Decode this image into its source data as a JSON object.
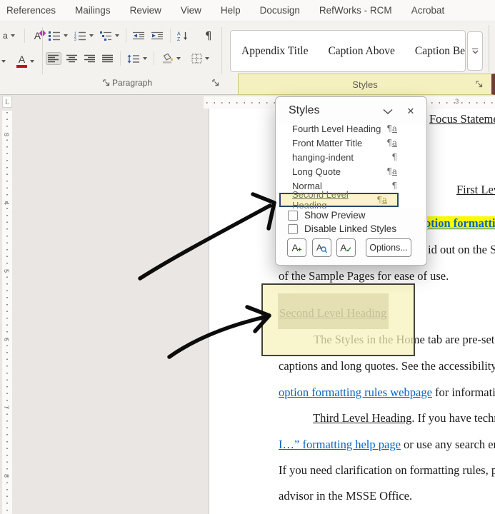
{
  "menu_tabs": [
    "References",
    "Mailings",
    "Review",
    "View",
    "Help",
    "Docusign",
    "RefWorks - RCM",
    "Acrobat"
  ],
  "ribbon": {
    "paragraph_group_label": "Paragraph",
    "gallery_items": [
      "Appendix Title",
      "Caption Above",
      "Caption Below"
    ],
    "styles_band_label": "Styles"
  },
  "styles_panel": {
    "title": "Styles",
    "items": [
      {
        "label": "Fourth Level Heading",
        "type": "linked",
        "selected": false
      },
      {
        "label": "Front Matter Title",
        "type": "linked",
        "selected": false
      },
      {
        "label": "hanging-indent",
        "type": "paragraph",
        "selected": false
      },
      {
        "label": "Long Quote",
        "type": "linked",
        "selected": false
      },
      {
        "label": "Normal",
        "type": "paragraph",
        "selected": false
      },
      {
        "label": "Second Level Heading",
        "type": "linked",
        "selected": true
      }
    ],
    "show_preview_label": "Show Preview",
    "show_preview_checked": false,
    "disable_linked_label": "Disable Linked Styles",
    "disable_linked_checked": false,
    "options_label": "Options..."
  },
  "rulers": {
    "h_number": "3",
    "v_numbers": [
      "3",
      "4",
      "5",
      "6",
      "7",
      "8"
    ]
  },
  "document": {
    "focus_heading": "Focus Statement",
    "first_level_heading": "First Level Heading",
    "highlighted_link_fragment": "ption formatting rul",
    "laid_out_fragment": "id out on the S",
    "sample_pages_line": "of the Sample Pages for ease of use.",
    "second_level_heading": "Second Level Heading",
    "styles_home_line": "The Styles in the Home tab are pre-set f",
    "captions_line": "captions and long quotes. See the accessibility g",
    "option_link": "option formatting rules webpage",
    "option_tail": " for informatio",
    "third_level_heading": "Third Level Heading",
    "third_tail": ". If you have techni",
    "help_link": "I…” formatting help page",
    "help_tail": " or use any search eng",
    "clarification_line": "If you need clarification on formatting rules, ple",
    "advisor_line": "advisor in the MSSE Office."
  },
  "icons": {
    "close": "✕",
    "pilcrow": "¶",
    "linked_a": "a",
    "corner_tab": "L"
  },
  "colors": {
    "link_blue": "#0563c1",
    "highlight_yellow": "#ffff00",
    "selection_navy": "#28456f",
    "band_yellow": "#f5f0c0"
  }
}
